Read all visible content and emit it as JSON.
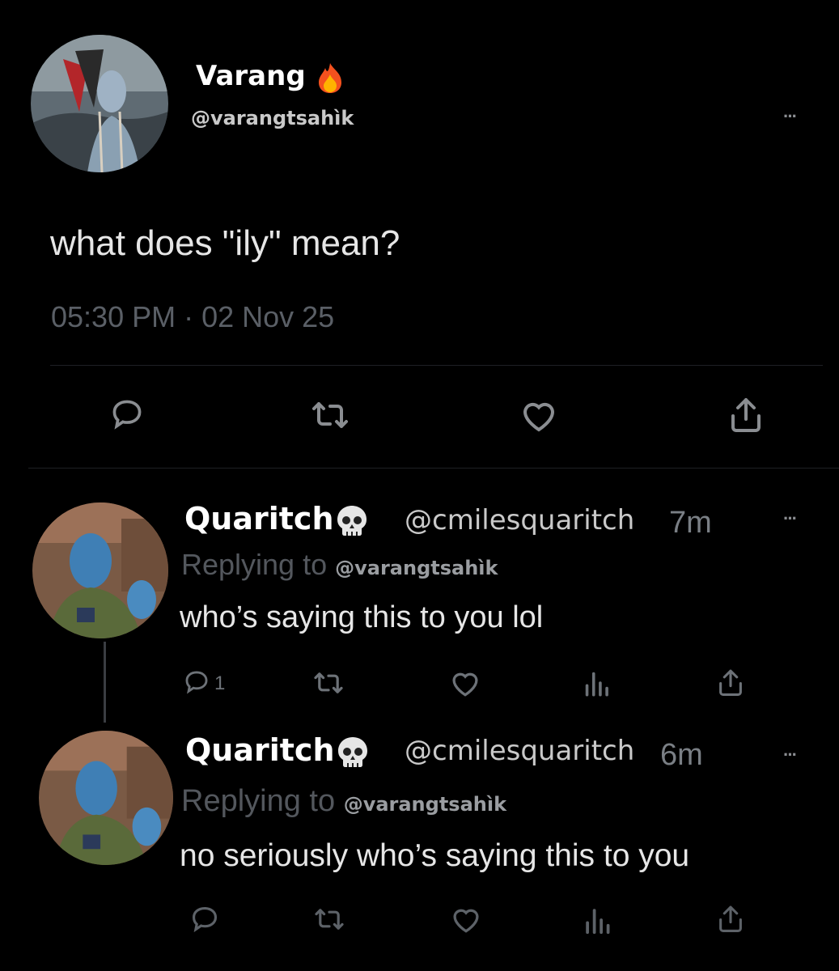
{
  "original_post": {
    "author_name": "Varang",
    "author_emoji": "fire-icon",
    "author_handle": "@varangtsahìk",
    "text": "what does \"ily\" mean?",
    "timestamp": "05:30 PM · 02 Nov 25",
    "more_label": "···",
    "actions": [
      "reply-icon",
      "repost-icon",
      "like-icon",
      "share-icon"
    ]
  },
  "replies": [
    {
      "author_name": "Quaritch",
      "author_emoji": "skull-icon",
      "author_handle": "@cmilesquaritch",
      "time_ago": "7m",
      "replying_prefix": "Replying to",
      "replying_handle": "@varangtsahìk",
      "text": "who’s saying this to you lol",
      "reply_count": "1",
      "more_label": "···",
      "actions": [
        "reply-icon",
        "repost-icon",
        "like-icon",
        "views-icon",
        "share-icon"
      ]
    },
    {
      "author_name": "Quaritch",
      "author_emoji": "skull-icon",
      "author_handle": "@cmilesquaritch",
      "time_ago": "6m",
      "replying_prefix": "Replying to",
      "replying_handle": "@varangtsahìk",
      "text": "no seriously who’s saying this to you",
      "more_label": "···",
      "actions": [
        "reply-icon",
        "repost-icon",
        "like-icon",
        "views-icon",
        "share-icon"
      ]
    }
  ],
  "colors": {
    "background": "#000000",
    "text_primary": "#ffffff",
    "text_secondary": "#6d7278",
    "divider": "#1e2024"
  }
}
